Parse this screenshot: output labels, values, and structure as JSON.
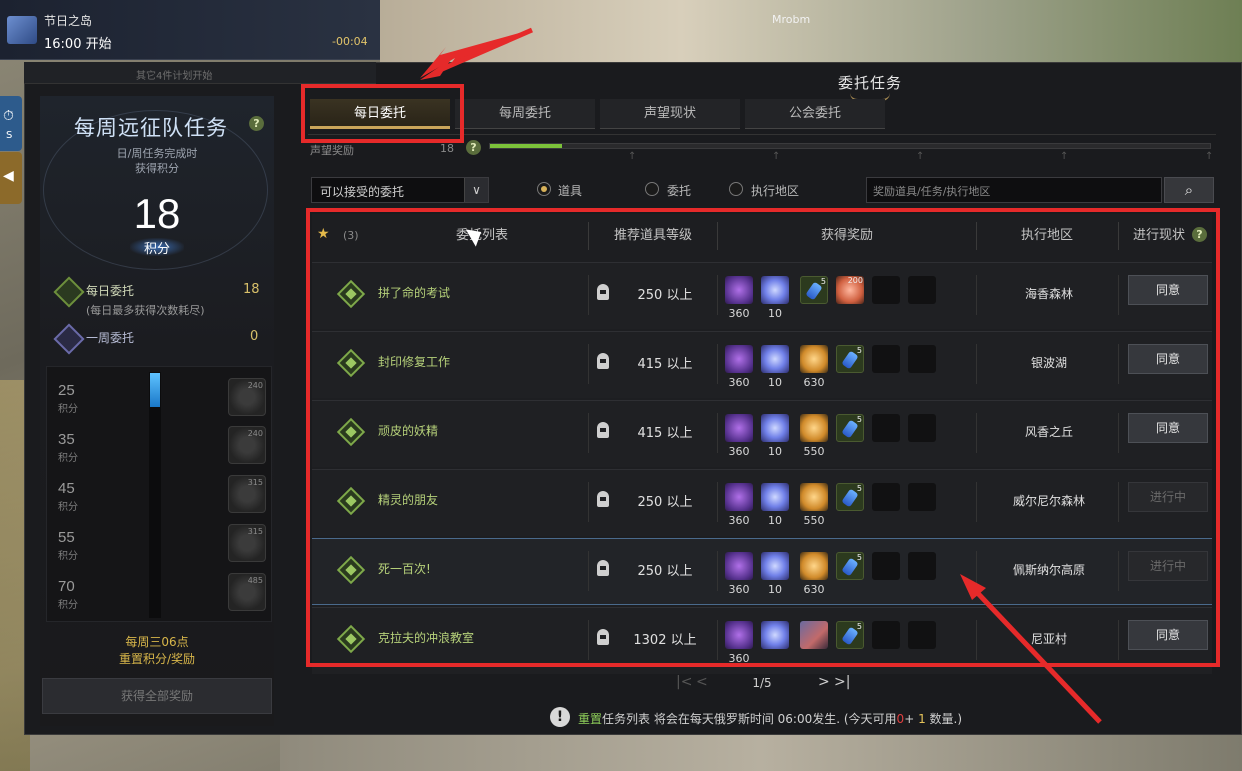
{
  "overlay_text": "Mrobm",
  "event": {
    "title": "节日之岛",
    "time": "16:00 开始",
    "countdown": "-00:04"
  },
  "sub_bar_text": "其它4件计划开始",
  "window": {
    "title": "委托任务"
  },
  "left_panel": {
    "title": "每周远征队任务",
    "help": "?",
    "subtitle_line1": "日/周任务完成时",
    "subtitle_line2": "获得积分",
    "score": "18",
    "score_unit": "积分",
    "daily": {
      "label": "每日委托",
      "value": "18",
      "note": "(每日最多获得次数耗尽)"
    },
    "weekly": {
      "label": "一周委托",
      "value": "0"
    },
    "progress_fraction": 0.14,
    "milestones": [
      {
        "points": "25",
        "unit": "积分",
        "reward_qty": "240"
      },
      {
        "points": "35",
        "unit": "积分",
        "reward_qty": "240"
      },
      {
        "points": "45",
        "unit": "积分",
        "reward_qty": "315"
      },
      {
        "points": "55",
        "unit": "积分",
        "reward_qty": "315"
      },
      {
        "points": "70",
        "unit": "积分",
        "reward_qty": "485"
      }
    ],
    "reset_line1": "每周三06点",
    "reset_line2": "重置积分/奖励",
    "claim_all": "获得全部奖励"
  },
  "side_tabs": {
    "tab1_icon": "stopwatch-icon",
    "tab1_label": "S",
    "tab2_icon": "horn-icon"
  },
  "tabs": [
    {
      "label": "每日委托",
      "active": true
    },
    {
      "label": "每周委托",
      "active": false
    },
    {
      "label": "声望现状",
      "active": false
    },
    {
      "label": "公会委托",
      "active": false
    }
  ],
  "reputation": {
    "label": "声望奖励",
    "value": "18",
    "progress_fraction": 0.1
  },
  "filter": {
    "dropdown_value": "可以接受的委托",
    "radios": [
      {
        "label": "道具",
        "checked": true
      },
      {
        "label": "委托",
        "checked": false
      },
      {
        "label": "执行地区",
        "checked": false
      }
    ],
    "search_placeholder": "奖励道具/任务/执行地区",
    "search_icon": "search-icon"
  },
  "table": {
    "favorites_count": "(3)",
    "headers": {
      "name": "委托列表",
      "level": "推荐道具等级",
      "rewards": "获得奖励",
      "region": "执行地区",
      "status": "进行现状"
    },
    "rows": [
      {
        "name": "拼了命的考试",
        "level": "250 以上",
        "region": "海香森林",
        "action": "同意",
        "disabled": false,
        "rewards": [
          {
            "type": "gem",
            "qty": "360"
          },
          {
            "type": "crystal",
            "qty": "10"
          },
          {
            "type": "potion",
            "qty": "",
            "badge": "5"
          },
          {
            "type": "heart",
            "qty": "",
            "badge": "200"
          },
          {
            "type": "empty",
            "qty": ""
          },
          {
            "type": "empty",
            "qty": ""
          }
        ]
      },
      {
        "name": "封印修复工作",
        "level": "415 以上",
        "region": "银波湖",
        "action": "同意",
        "disabled": false,
        "rewards": [
          {
            "type": "gem",
            "qty": "360"
          },
          {
            "type": "crystal",
            "qty": "10"
          },
          {
            "type": "coin",
            "qty": "630"
          },
          {
            "type": "potion",
            "qty": "",
            "badge": "5"
          },
          {
            "type": "empty",
            "qty": ""
          },
          {
            "type": "empty",
            "qty": ""
          }
        ]
      },
      {
        "name": "顽皮的妖精",
        "level": "415 以上",
        "region": "风香之丘",
        "action": "同意",
        "disabled": false,
        "rewards": [
          {
            "type": "gem",
            "qty": "360"
          },
          {
            "type": "crystal",
            "qty": "10"
          },
          {
            "type": "coin",
            "qty": "550"
          },
          {
            "type": "potion",
            "qty": "",
            "badge": "5"
          },
          {
            "type": "empty",
            "qty": ""
          },
          {
            "type": "empty",
            "qty": ""
          }
        ]
      },
      {
        "name": "精灵的朋友",
        "level": "250 以上",
        "region": "威尔尼尔森林",
        "action": "进行中",
        "disabled": true,
        "rewards": [
          {
            "type": "gem",
            "qty": "360"
          },
          {
            "type": "crystal",
            "qty": "10"
          },
          {
            "type": "coin",
            "qty": "550"
          },
          {
            "type": "potion",
            "qty": "",
            "badge": "5"
          },
          {
            "type": "empty",
            "qty": ""
          },
          {
            "type": "empty",
            "qty": ""
          }
        ]
      },
      {
        "name": "死一百次!",
        "level": "250 以上",
        "region": "佩斯纳尔高原",
        "action": "进行中",
        "disabled": true,
        "rewards": [
          {
            "type": "gem",
            "qty": "360"
          },
          {
            "type": "crystal",
            "qty": "10"
          },
          {
            "type": "coin",
            "qty": "630"
          },
          {
            "type": "potion",
            "qty": "",
            "badge": "5"
          },
          {
            "type": "empty",
            "qty": ""
          },
          {
            "type": "empty",
            "qty": ""
          }
        ]
      },
      {
        "name": "克拉夫的冲浪教室",
        "level": "1302 以上",
        "region": "尼亚村",
        "action": "同意",
        "disabled": false,
        "rewards": [
          {
            "type": "gem",
            "qty": "360"
          },
          {
            "type": "crystal",
            "qty": ""
          },
          {
            "type": "feather",
            "qty": ""
          },
          {
            "type": "potion",
            "qty": "",
            "badge": "5"
          },
          {
            "type": "empty",
            "qty": ""
          },
          {
            "type": "empty",
            "qty": ""
          }
        ]
      }
    ]
  },
  "pager": {
    "first": "|<",
    "prev": "<",
    "page": "1/5",
    "next": ">",
    "last": ">|"
  },
  "notice": {
    "icon": "!",
    "highlight": "重置",
    "text": "任务列表 将会在每天俄罗斯时间 06:00发生. (今天可用",
    "red": "0",
    "plus": "+",
    "count": "1",
    "suffix": "数量.)"
  }
}
